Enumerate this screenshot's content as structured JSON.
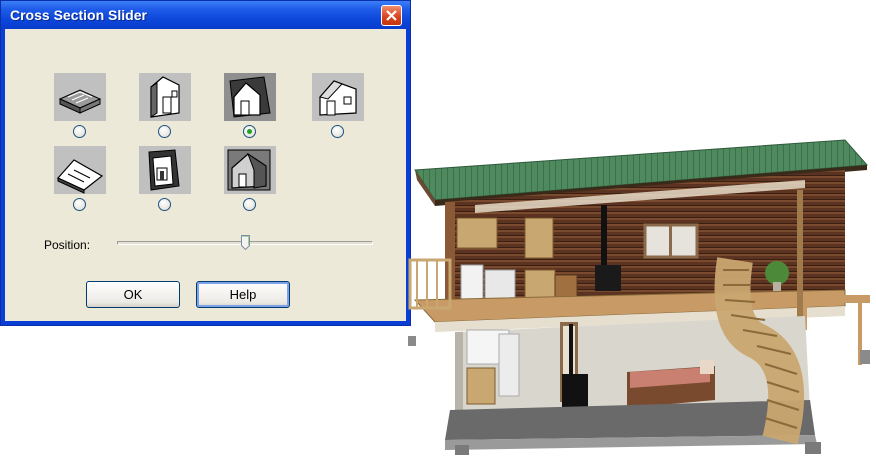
{
  "dialog": {
    "title": "Cross Section Slider",
    "options": [
      {
        "name": "floor-plan-view-icon",
        "selected": false
      },
      {
        "name": "side-section-view-icon",
        "selected": false
      },
      {
        "name": "cross-section-view-icon",
        "selected": true
      },
      {
        "name": "front-elevation-icon",
        "selected": false
      },
      {
        "name": "roof-section-view-icon",
        "selected": false
      },
      {
        "name": "back-section-view-icon",
        "selected": false
      },
      {
        "name": "cutaway-view-icon",
        "selected": false
      }
    ],
    "position_label": "Position:",
    "slider_position": 0.5,
    "ok_label": "OK",
    "help_label": "Help"
  },
  "colors": {
    "titlebar": "#0b45d9",
    "dialog_face": "#ece9d8",
    "roof": "#4f8a5e",
    "log_wall": "#5b3320",
    "floor_wood": "#c79a66"
  }
}
